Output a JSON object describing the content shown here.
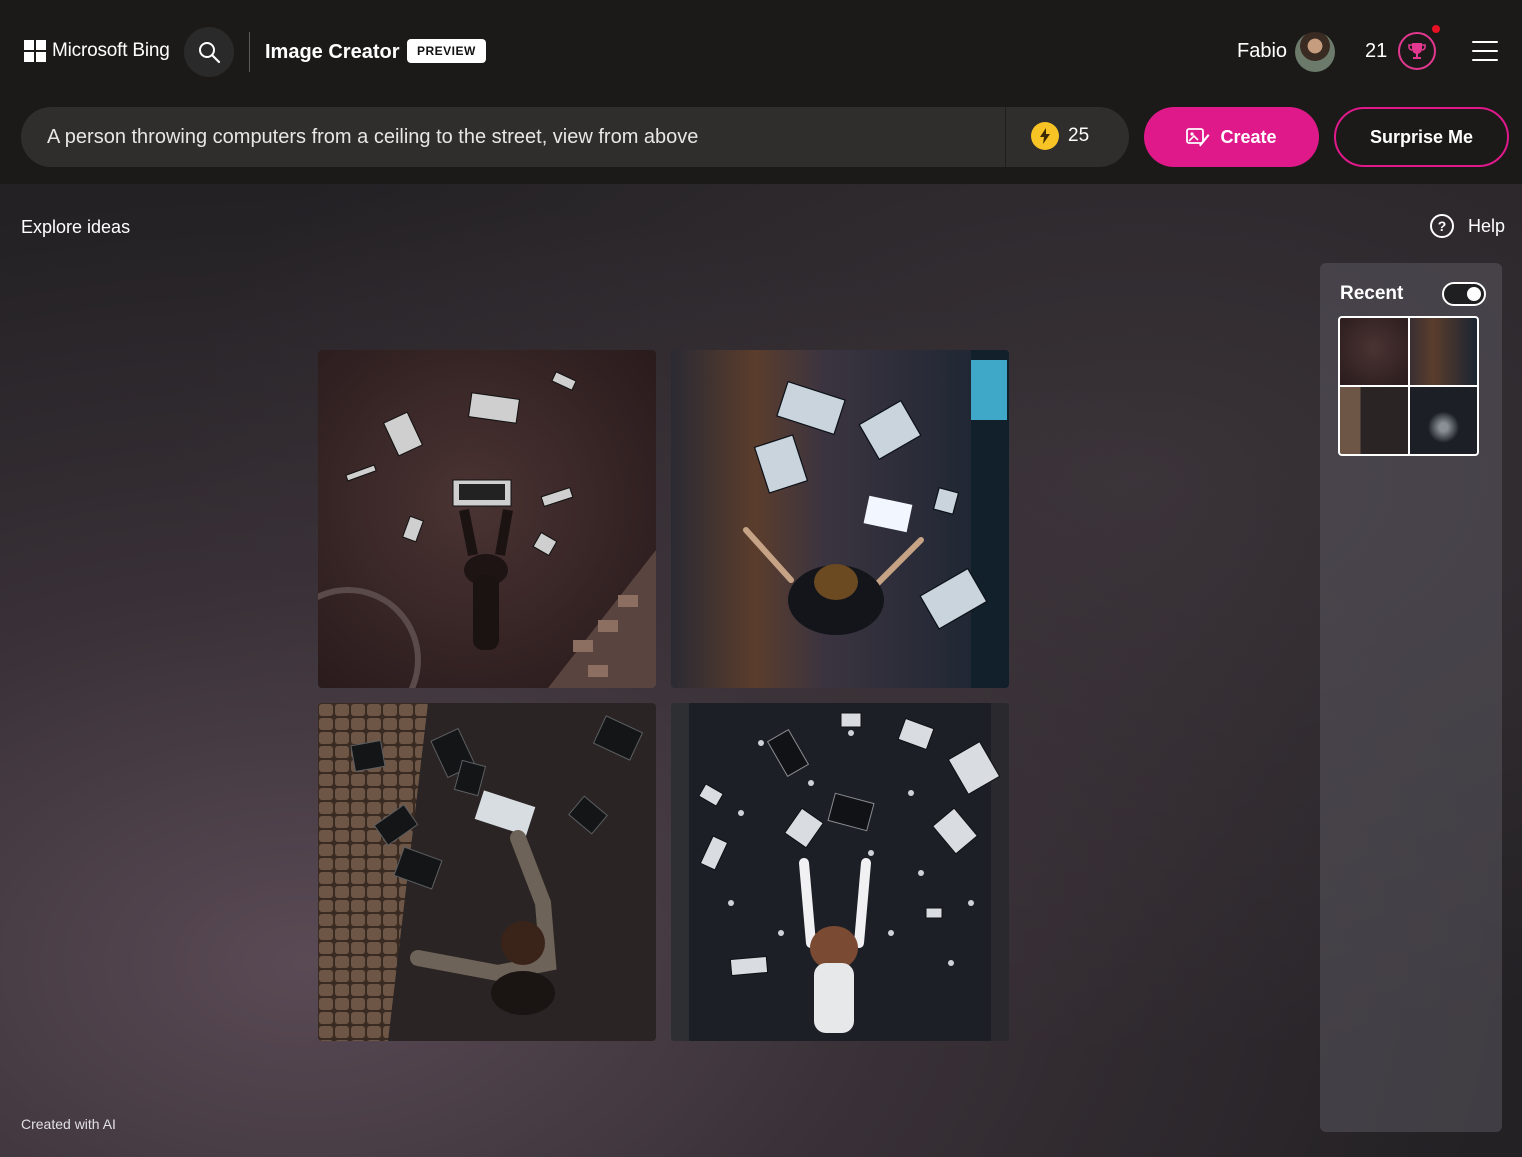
{
  "header": {
    "brand": "Microsoft Bing",
    "product": "Image Creator",
    "badge": "PREVIEW",
    "user": "Fabio",
    "points": "21",
    "icons": {
      "logo": "windows-logo-icon",
      "search": "search-icon",
      "rewards": "trophy-icon",
      "menu": "hamburger-menu-icon"
    }
  },
  "prompt": {
    "text": "A person throwing computers from a ceiling to the street, view from above",
    "boosts": "25",
    "create_label": "Create",
    "surprise_label": "Surprise Me"
  },
  "main": {
    "explore": "Explore ideas",
    "help": "Help",
    "footer": "Created with AI"
  },
  "recent": {
    "title": "Recent",
    "toggle_on": true
  },
  "colors": {
    "accent": "#e0198a",
    "boost": "#f7c325",
    "header_bg": "#1b1a19"
  }
}
